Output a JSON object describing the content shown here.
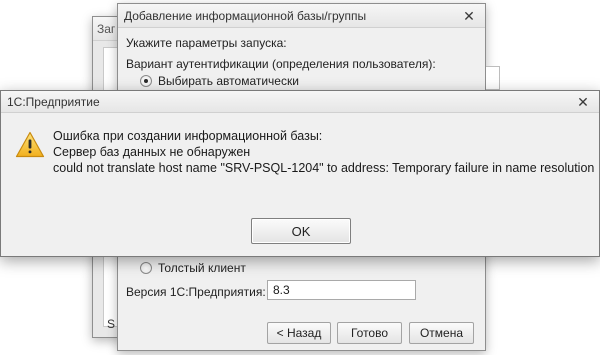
{
  "back_window": {
    "title_partial": "Заг",
    "bottom_letter": "S"
  },
  "add_dialog": {
    "title": "Добавление информационной базы/группы",
    "close_glyph": "✕",
    "launch_params_label": "Укажите параметры запуска:",
    "auth_label": "Вариант аутентификации (определения пользователя):",
    "auth_option_auto": "Выбирать автоматически",
    "client_option_thick": "Толстый клиент",
    "version_label": "Версия 1С:Предприятия:",
    "version_value": "8.3",
    "back_button": "< Назад",
    "finish_button": "Готово",
    "cancel_button": "Отмена"
  },
  "error_dialog": {
    "title": "1С:Предприятие",
    "close_glyph": "✕",
    "icon": "warning-icon",
    "line1": "Ошибка при создании информационной базы:",
    "line2": "Сервер баз данных не обнаружен",
    "line3": "could not translate host name \"SRV-PSQL-1204\" to address: Temporary failure in name resolution",
    "ok_button": "OK"
  }
}
